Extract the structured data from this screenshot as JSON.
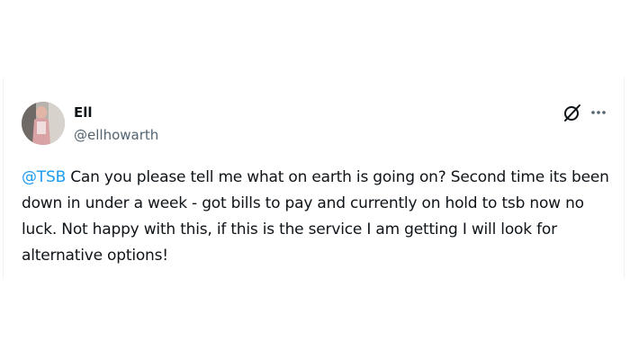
{
  "tweet": {
    "author_name": "Ell",
    "author_handle": "@ellhowarth",
    "mention": "@TSB",
    "body": " Can you please tell me what on earth is going on? Second time its been down in under a week - got bills to pay and currently on hold to tsb now no luck. Not happy with this, if this is the service I am getting I will look for alternative options!",
    "icons": {
      "grok": "grok-icon",
      "more": "more-options-icon"
    },
    "colors": {
      "link": "#1d9bf0",
      "text": "#0f1419",
      "secondary": "#536471"
    }
  }
}
